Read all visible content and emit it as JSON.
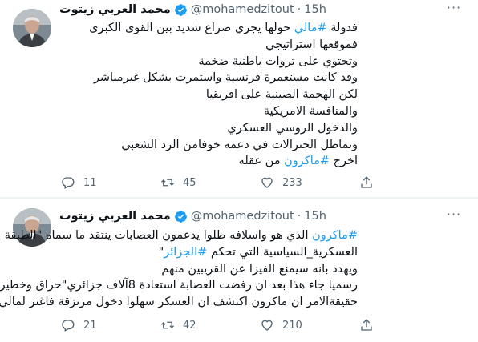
{
  "tweets": [
    {
      "author_name": "محمد العربي زيتوت",
      "handle": "@mohamedzitout",
      "separator": "·",
      "time": "15h",
      "more_label": "···",
      "lines": [
        [
          {
            "t": "فدولة "
          },
          {
            "t": "#مالي",
            "tag": true
          },
          {
            "t": " حولها يجري صراع شديد بين القوى الكبرى"
          }
        ],
        [
          {
            "t": "فموقعها استراتيجي"
          }
        ],
        [
          {
            "t": "وتحتوي على ثروات باطنية ضخمة"
          }
        ],
        [
          {
            "t": "وقد كانت مستعمرة فرنسية واستمرت بشكل غيرمباشر"
          }
        ],
        [
          {
            "t": "لكن الهجمة الصينية على افريقيا"
          }
        ],
        [
          {
            "t": "والمنافسة الامريكية"
          }
        ],
        [
          {
            "t": "والدخول الروسي العسكري"
          }
        ],
        [
          {
            "t": "وتماطل الجنرالات في دعمه خوفامن الرد الشعبي"
          }
        ],
        [
          {
            "t": "اخرج "
          },
          {
            "t": "#ماكرون",
            "tag": true
          },
          {
            "t": " من عقله"
          }
        ]
      ],
      "replies": "11",
      "retweets": "45",
      "likes": "233"
    },
    {
      "author_name": "محمد العربي زيتوت",
      "handle": "@mohamedzitout",
      "separator": "·",
      "time": "15h",
      "more_label": "···",
      "lines": [
        [
          {
            "t": "#ماكرون",
            "tag": true
          },
          {
            "t": " الذي هو واسلافه ظلوا يدعمون العصابات ينتقد ما سماه \"الطبقة"
          }
        ],
        [
          {
            "t": "العسكرية_السياسية التي تحكم "
          },
          {
            "t": "#الجزائر",
            "tag": true
          },
          {
            "t": "\""
          }
        ],
        [
          {
            "t": "ويهدد بانه سيمنع الفيزا عن القريبين منهم"
          }
        ],
        [
          {
            "t": "رسميا جاء هذا بعد ان رفضت العصابة استعادة 8آلاف جزائري\"حراڨ وخطير\""
          }
        ],
        [
          {
            "t": "حقيقةالامر ان ماكرون  اكتشف ان العسكر سهلوا دخول مرتزقة فاغنر لمالي"
          }
        ]
      ],
      "replies": "21",
      "retweets": "42",
      "likes": "210"
    }
  ],
  "icons": {
    "verified": "verified-badge-icon",
    "reply": "reply-icon",
    "retweet": "retweet-icon",
    "like": "heart-icon",
    "share": "share-icon",
    "more": "more-icon"
  },
  "colors": {
    "accent": "#1d9bf0",
    "text": "#0f1419",
    "secondary": "#536471",
    "divider": "#eff3f4"
  }
}
